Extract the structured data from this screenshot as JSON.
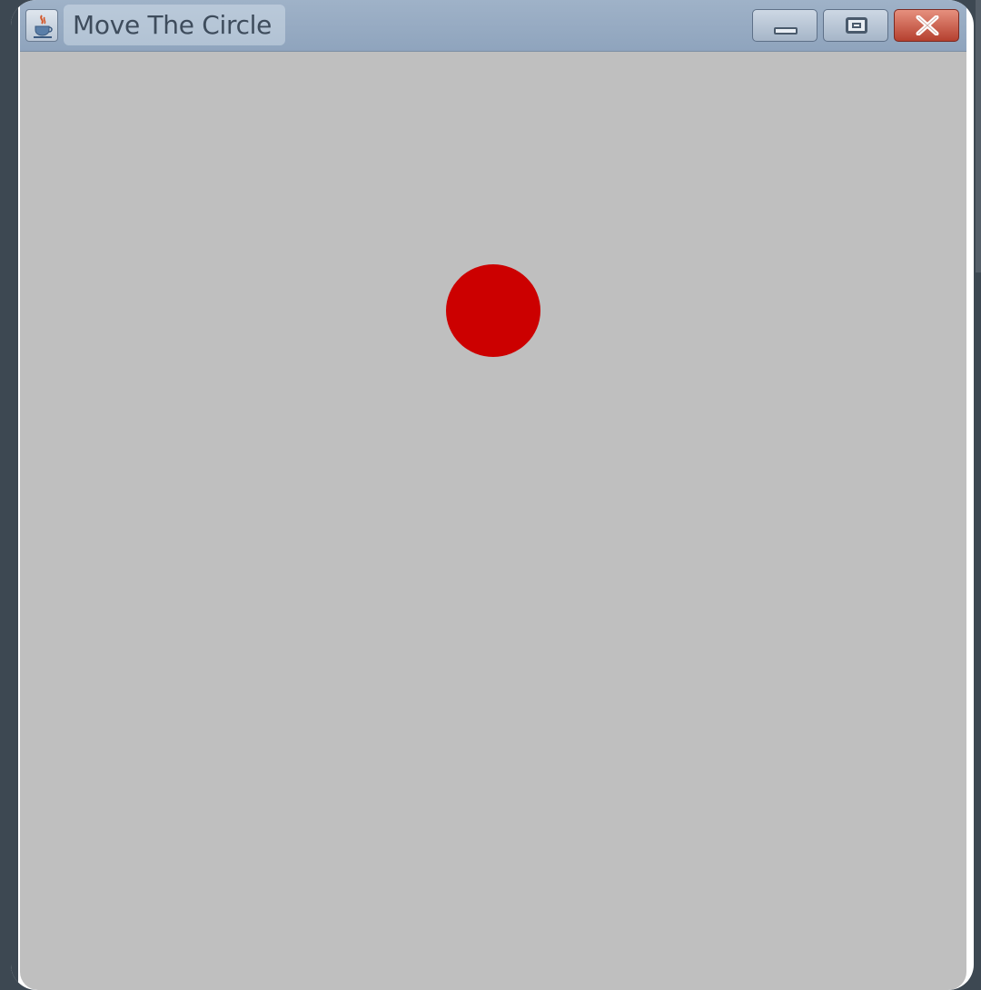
{
  "window": {
    "title": "Move The Circle",
    "app_icon": "java-cup-icon",
    "controls": {
      "minimize": "minimize-icon",
      "maximize": "maximize-icon",
      "close": "close-icon"
    }
  },
  "canvas": {
    "background_color": "#bfbfbf",
    "circle": {
      "color": "#cc0000"
    }
  },
  "colors": {
    "titlebar": "#9fb2c8",
    "close_button": "#c0503f"
  }
}
